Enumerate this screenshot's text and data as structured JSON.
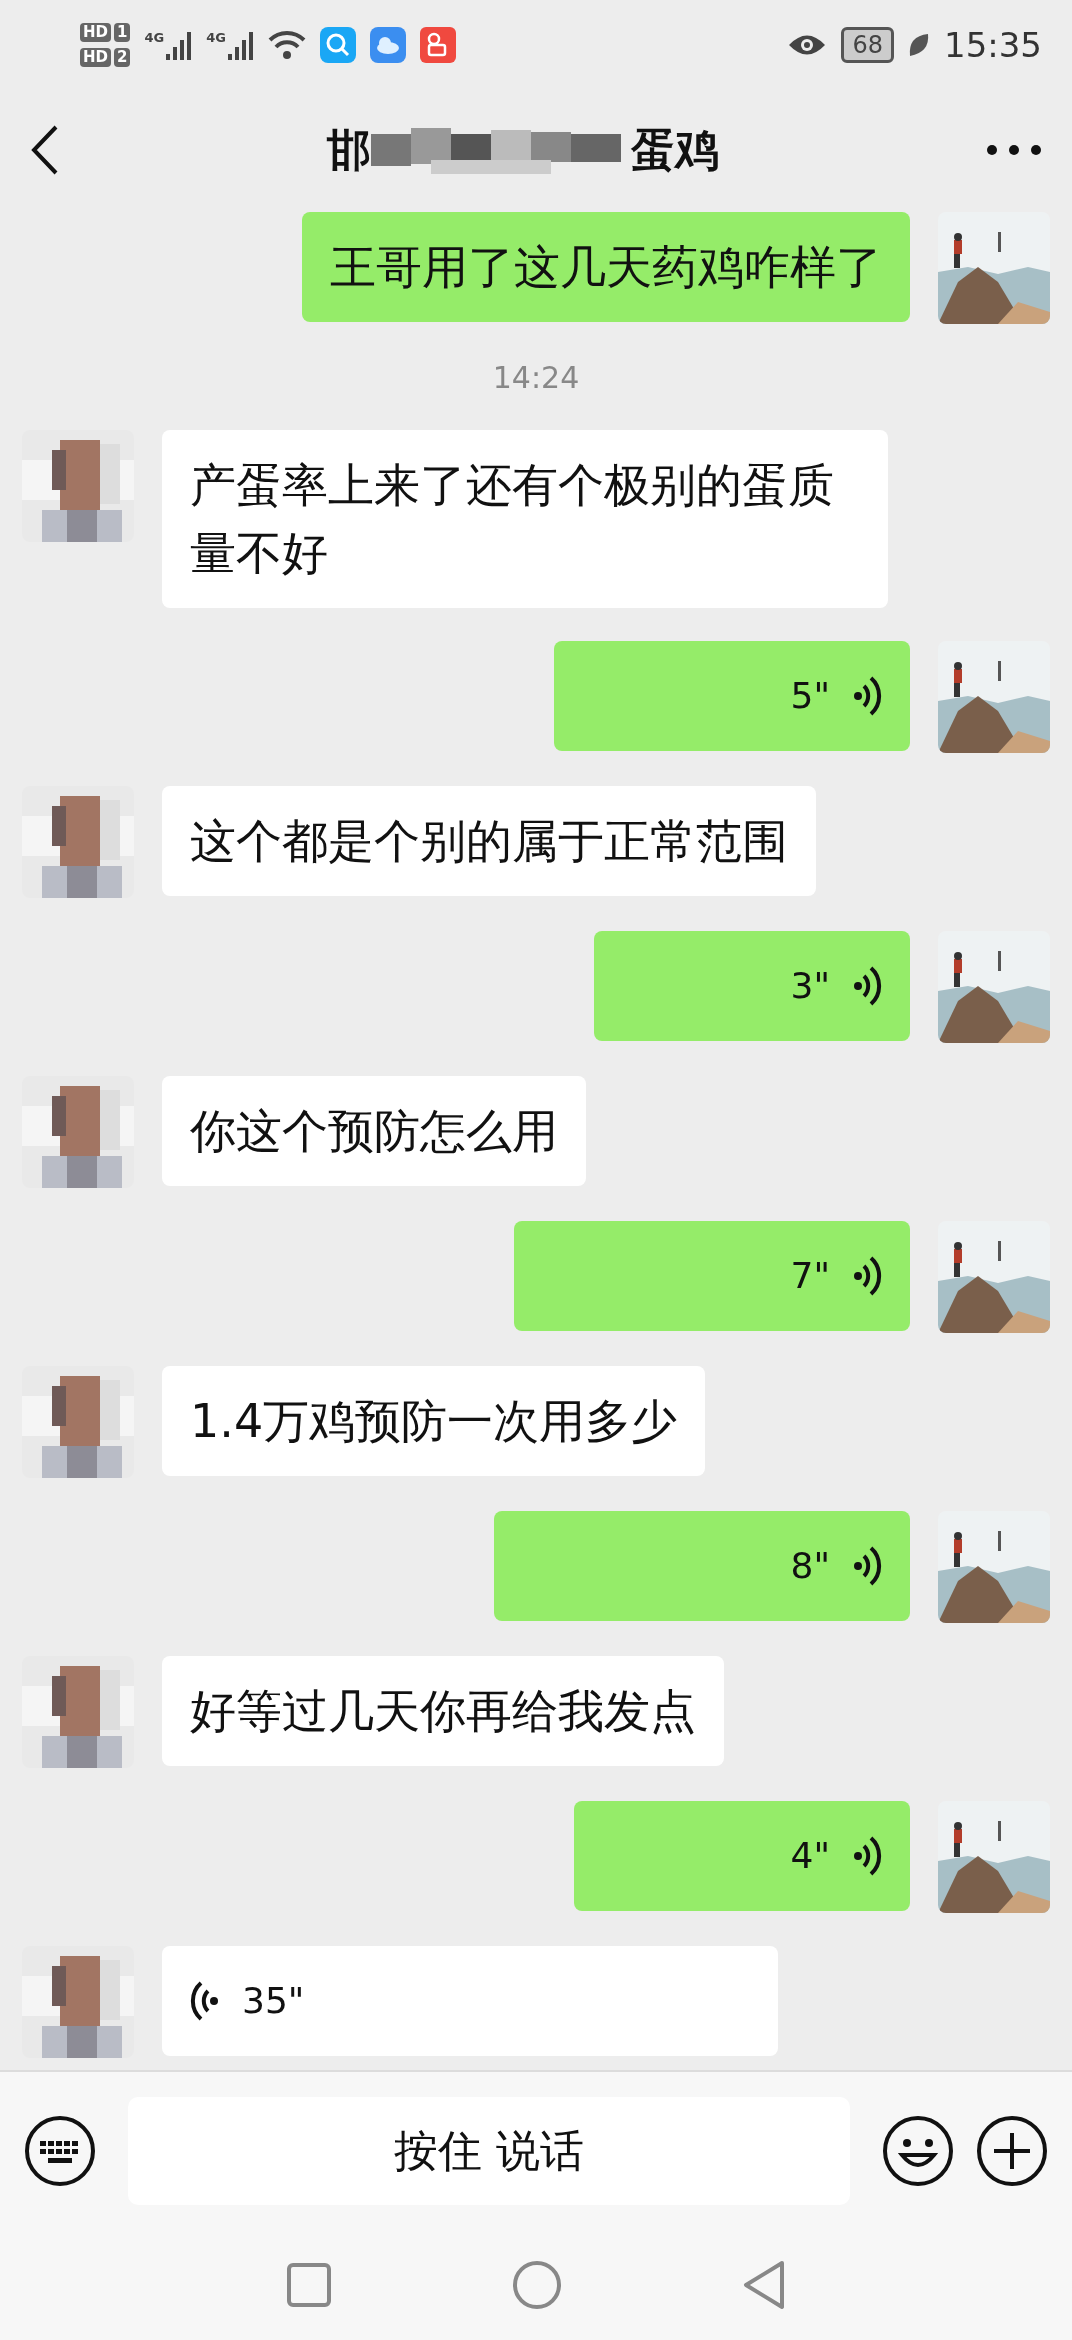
{
  "status_bar": {
    "sim_badges": [
      {
        "label": "HD",
        "slot": "1"
      },
      {
        "label": "HD",
        "slot": "2"
      }
    ],
    "networks": [
      "4G",
      "4G"
    ],
    "battery": "68",
    "time": "15:35"
  },
  "header": {
    "title_start": "邯",
    "title_end": "蛋鸡"
  },
  "messages": [
    {
      "kind": "text",
      "outgoing": true,
      "text": "王哥用了这几天药鸡咋样了"
    },
    {
      "kind": "time",
      "text": "14:24"
    },
    {
      "kind": "text",
      "outgoing": false,
      "text": "产蛋率上来了还有个极别的蛋质量不好"
    },
    {
      "kind": "voice",
      "outgoing": true,
      "duration": "5\""
    },
    {
      "kind": "text",
      "outgoing": false,
      "text": "这个都是个别的属于正常范围"
    },
    {
      "kind": "voice",
      "outgoing": true,
      "duration": "3\""
    },
    {
      "kind": "text",
      "outgoing": false,
      "text": "你这个预防怎么用"
    },
    {
      "kind": "voice",
      "outgoing": true,
      "duration": "7\""
    },
    {
      "kind": "text",
      "outgoing": false,
      "text": "1.4万鸡预防一次用多少"
    },
    {
      "kind": "voice",
      "outgoing": true,
      "duration": "8\""
    },
    {
      "kind": "text",
      "outgoing": false,
      "text": "好等过几天你再给我发点"
    },
    {
      "kind": "voice",
      "outgoing": true,
      "duration": "4\""
    },
    {
      "kind": "voice",
      "outgoing": false,
      "duration": "35\""
    }
  ],
  "input_bar": {
    "hold_to_talk": "按住 说话"
  }
}
